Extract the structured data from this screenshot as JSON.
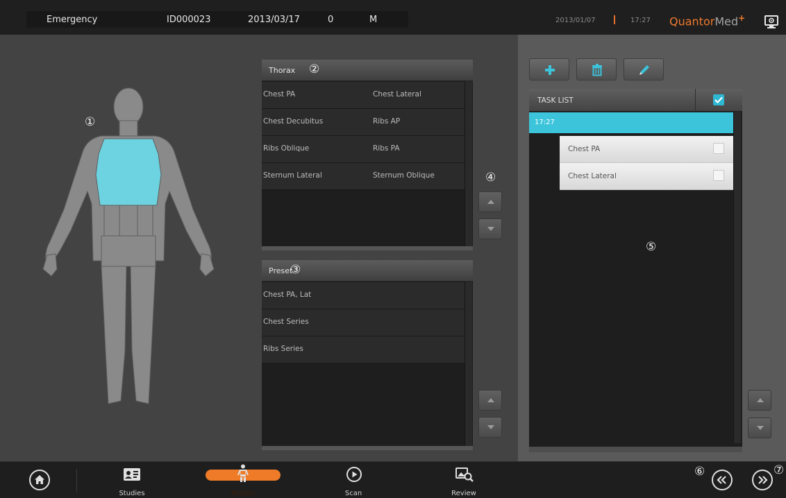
{
  "header": {
    "patient_type": "Emergency",
    "patient_id": "ID000023",
    "birth_date": "2013/03/17",
    "age": "0",
    "sex": "M",
    "date": "2013/01/07",
    "time": "17:27",
    "logo_part1": "Quantor",
    "logo_part2": "Med",
    "logo_plus": "+",
    "monitor_icon": "monitor-settings-icon"
  },
  "callouts": {
    "body_map": "①",
    "protocols": "②",
    "presets": "③",
    "scroll_buttons": "④",
    "task_list": "⑤",
    "prev": "⑥",
    "next": "⑦"
  },
  "body_map": {
    "highlighted_region": "Thorax",
    "highlight_color": "#6dd3e0",
    "body_color": "#8a8a8a"
  },
  "protocols": {
    "title": "Thorax",
    "rows": [
      [
        "Chest PA",
        "Chest Lateral"
      ],
      [
        "Chest Decubitus",
        "Ribs AP"
      ],
      [
        "Ribs Oblique",
        "Ribs PA"
      ],
      [
        "Sternum Lateral",
        "Sternum Oblique"
      ]
    ]
  },
  "presets": {
    "title": "Preset",
    "rows": [
      "Chest PA, Lat",
      "Chest Series",
      "Ribs Series"
    ]
  },
  "toolbar": {
    "icons": [
      "add-icon",
      "trash-icon",
      "edit-pencil-icon"
    ]
  },
  "task_list": {
    "title": "TASK LIST",
    "select_all_checked": true,
    "group_label": "17:27",
    "tasks": [
      {
        "name": "Chest PA",
        "checked": false
      },
      {
        "name": "Chest Lateral",
        "checked": false
      }
    ],
    "accent_color": "#3cc4db"
  },
  "bottom_nav": {
    "home_icon": "home-icon",
    "items": [
      {
        "label": "Studies",
        "icon": "patient-card-icon"
      },
      {
        "label": "Region",
        "icon": "body-region-icon",
        "active": true
      },
      {
        "label": "Scan",
        "icon": "play-icon"
      },
      {
        "label": "Review",
        "icon": "image-review-icon"
      }
    ],
    "prev_icon": "double-chevron-left-icon",
    "next_icon": "double-chevron-right-icon",
    "active_color": "#ef7b29"
  }
}
